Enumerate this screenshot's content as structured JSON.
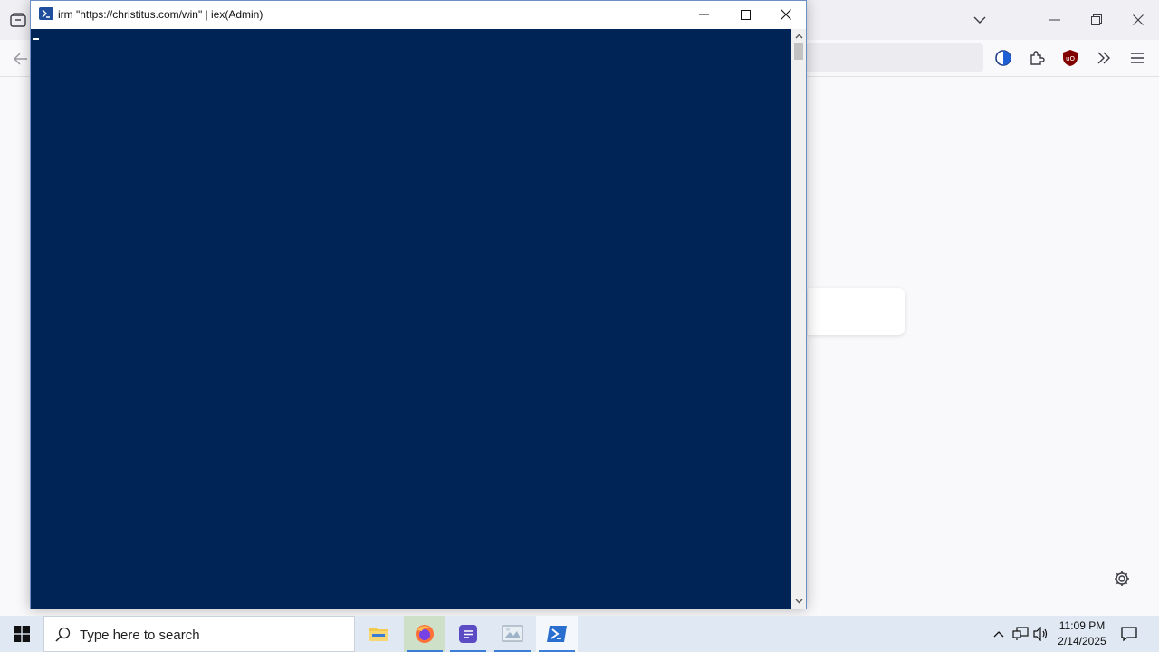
{
  "powershell_window": {
    "title": "irm \"https://christitus.com/win\" | iex(Admin)",
    "console_background": "#012456"
  },
  "taskbar": {
    "search_placeholder": "Type here to search",
    "apps": [
      {
        "name": "File Explorer",
        "icon": "folder-icon"
      },
      {
        "name": "Firefox",
        "icon": "firefox-icon"
      },
      {
        "name": "Notes",
        "icon": "notes-app-icon"
      },
      {
        "name": "Photos",
        "icon": "photos-icon"
      },
      {
        "name": "Windows PowerShell",
        "icon": "powershell-icon"
      }
    ],
    "clock": {
      "time": "11:09 PM",
      "date": "2/14/2025"
    }
  },
  "colors": {
    "accent": "#3b7ed8",
    "taskbar": "#dfe8f3",
    "console": "#012456",
    "ublock": "#800000"
  }
}
